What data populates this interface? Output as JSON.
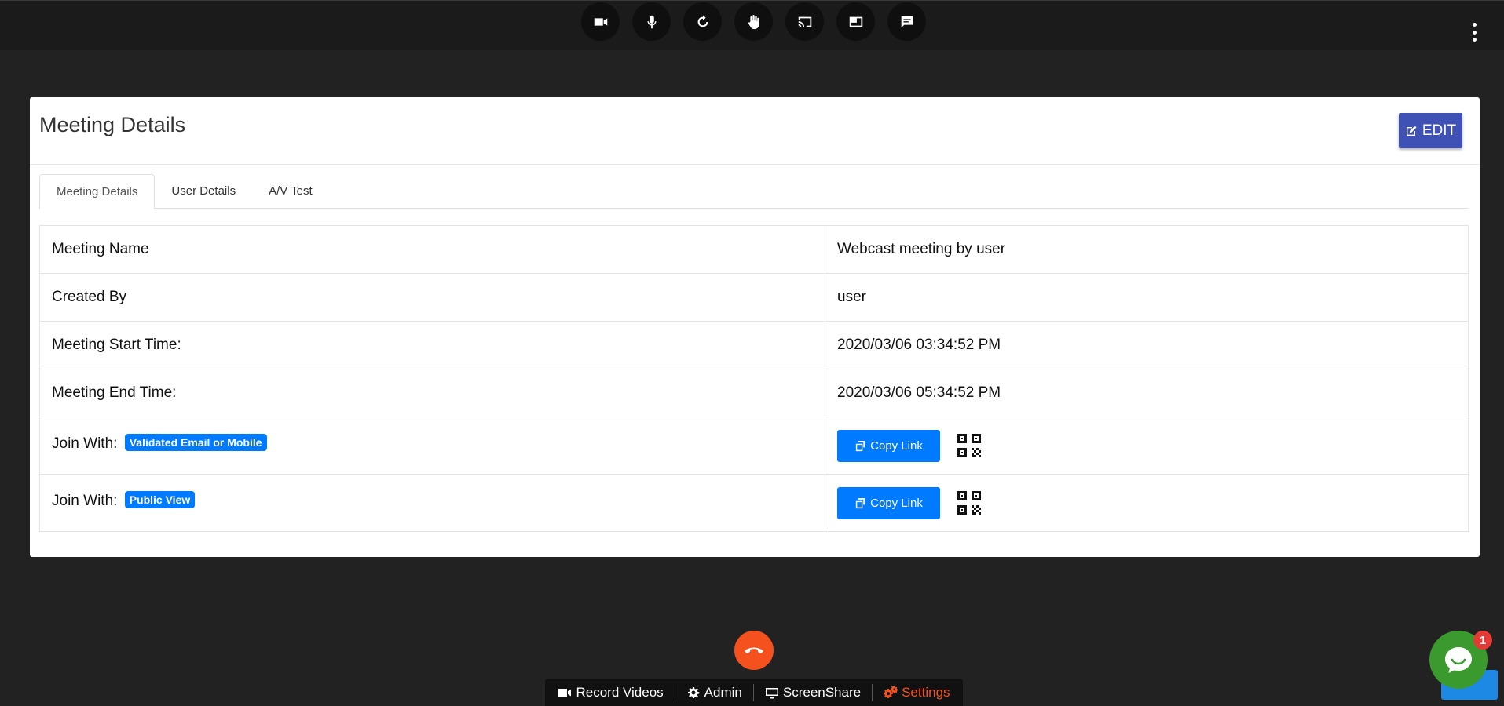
{
  "top_controls": [
    {
      "name": "camera-icon"
    },
    {
      "name": "microphone-icon"
    },
    {
      "name": "refresh-icon"
    },
    {
      "name": "raise-hand-icon"
    },
    {
      "name": "cast-icon"
    },
    {
      "name": "layout-icon"
    },
    {
      "name": "chat-icon"
    }
  ],
  "card": {
    "title": "Meeting Details",
    "edit_label": "EDIT"
  },
  "tabs": [
    {
      "label": "Meeting Details",
      "active": true
    },
    {
      "label": "User Details",
      "active": false
    },
    {
      "label": "A/V Test",
      "active": false
    }
  ],
  "details": {
    "meeting_name_label": "Meeting Name",
    "meeting_name_value": "Webcast meeting by user",
    "created_by_label": "Created By",
    "created_by_value": "user",
    "start_time_label": "Meeting Start Time:",
    "start_time_value": "2020/03/06 03:34:52 PM",
    "end_time_label": "Meeting End Time:",
    "end_time_value": "2020/03/06 05:34:52 PM",
    "join1_label": "Join With:",
    "join1_badge": "Validated Email or Mobile",
    "join2_label": "Join With:",
    "join2_badge": "Public View",
    "copy_link_label": "Copy Link"
  },
  "bottom_bar": {
    "record_label": "Record Videos",
    "admin_label": "Admin",
    "screenshare_label": "ScreenShare",
    "settings_label": "Settings"
  },
  "chat": {
    "unread_count": "1"
  },
  "colors": {
    "accent_indigo": "#3f51b5",
    "primary_blue": "#007bff",
    "hangup_orange": "#f4511e",
    "chat_green": "#3a9a2e"
  }
}
